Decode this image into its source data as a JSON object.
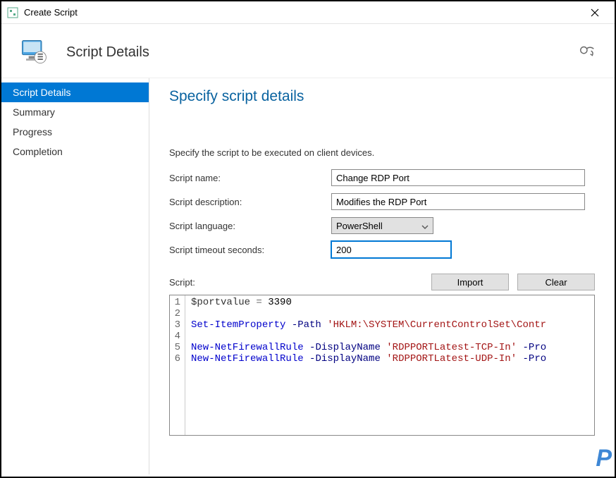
{
  "window": {
    "title": "Create Script"
  },
  "header": {
    "title": "Script Details"
  },
  "sidebar": {
    "items": [
      {
        "label": "Script Details",
        "active": true
      },
      {
        "label": "Summary",
        "active": false
      },
      {
        "label": "Progress",
        "active": false
      },
      {
        "label": "Completion",
        "active": false
      }
    ]
  },
  "main": {
    "heading": "Specify script details",
    "subtext": "Specify the script to be executed on client devices.",
    "labels": {
      "name": "Script name:",
      "description": "Script description:",
      "language": "Script language:",
      "timeout": "Script timeout seconds:",
      "script": "Script:"
    },
    "values": {
      "name": "Change RDP Port",
      "description": "Modifies the RDP Port",
      "language": "PowerShell",
      "timeout": "200"
    },
    "buttons": {
      "import": "Import",
      "clear": "Clear"
    },
    "code": {
      "lines": [
        "1",
        "2",
        "3",
        "4",
        "5",
        "6"
      ],
      "l1_var": "$portvalue",
      "l1_op": " = ",
      "l1_num": "3390",
      "l3_cmd": "Set-ItemProperty",
      "l3_p1": " -Path ",
      "l3_s1": "'HKLM:\\SYSTEM\\CurrentControlSet\\Contr",
      "l5_cmd": "New-NetFirewallRule",
      "l5_p1": " -DisplayName ",
      "l5_s1": "'RDPPORTLatest-TCP-In'",
      "l5_p2": " -Pro",
      "l6_cmd": "New-NetFirewallRule",
      "l6_p1": " -DisplayName ",
      "l6_s1": "'RDPPORTLatest-UDP-In'",
      "l6_p2": " -Pro"
    }
  }
}
